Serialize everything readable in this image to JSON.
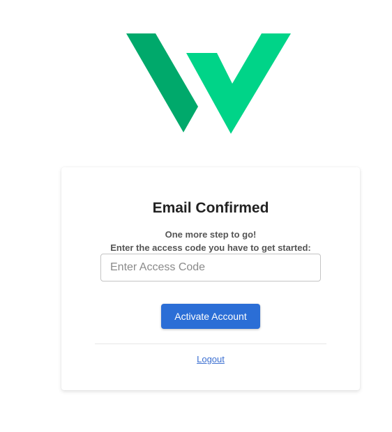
{
  "brand": {
    "logo_icon": "w-logo-icon",
    "colors": {
      "logo_dark": "#00a96b",
      "logo_light": "#00d488"
    }
  },
  "card": {
    "title": "Email Confirmed",
    "subtitle_line1": "One more step to go!",
    "subtitle_line2": "Enter the access code you have to get started:",
    "access_code": {
      "value": "",
      "placeholder": "Enter Access Code"
    },
    "activate_label": "Activate Account",
    "logout_label": "Logout"
  },
  "colors": {
    "primary_button": "#2b6ed6",
    "link": "#3b6fd1"
  }
}
